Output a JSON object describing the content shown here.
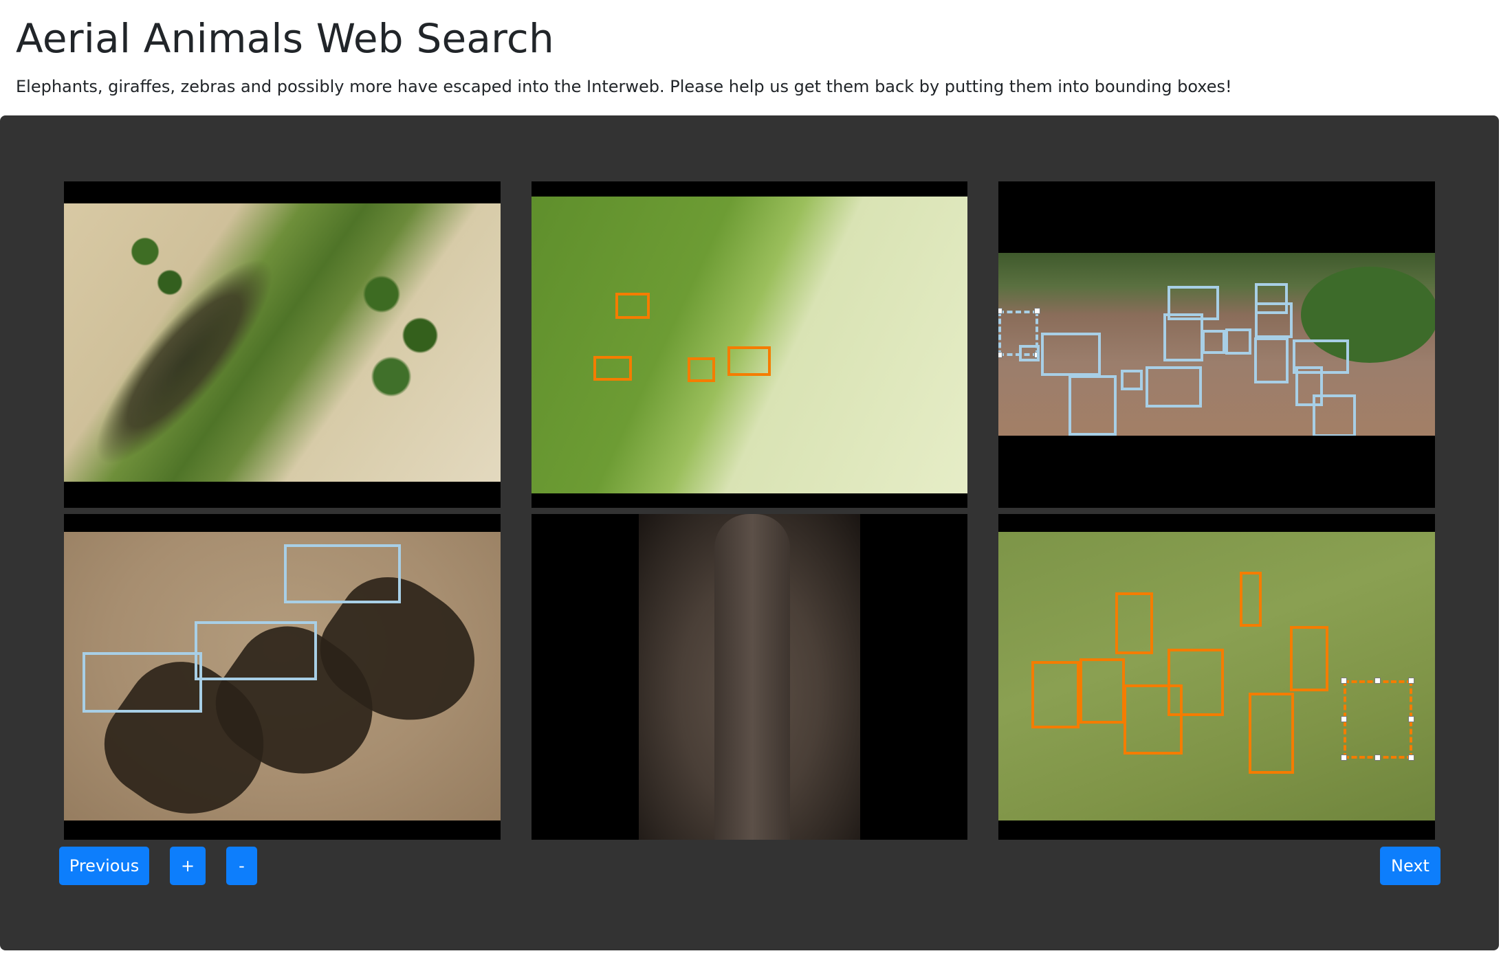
{
  "page": {
    "title": "Aerial Animals Web Search",
    "subtitle": "Elephants, giraffes, zebras and possibly more have escaped into the Interweb. Please help us get them back by putting them into bounding boxes!"
  },
  "images": [
    {
      "id": "grid-image-1",
      "subject": "herd of animals crossing grassland",
      "annotations": 0
    },
    {
      "id": "grid-image-2",
      "subject": "zebras in marsh",
      "label_color": "#f57c00",
      "annotations": 5
    },
    {
      "id": "grid-image-3",
      "subject": "elephants in river",
      "label_color": "#a8cfe6",
      "annotations": 21
    },
    {
      "id": "grid-image-4",
      "subject": "three elephants with shadows",
      "label_color": "#a8cfe6",
      "annotations": 3
    },
    {
      "id": "grid-image-5",
      "subject": "elephant trunk close-up",
      "annotations": 0
    },
    {
      "id": "grid-image-6",
      "subject": "zebra herd on grass",
      "label_color": "#f57c00",
      "annotations": 10
    }
  ],
  "controls": {
    "previous_label": "Previous",
    "zoom_in_label": "+",
    "zoom_out_label": "-",
    "next_label": "Next"
  },
  "colors": {
    "panel": "#333333",
    "button": "#0d7efc",
    "elephant_box": "#a8cfe6",
    "zebra_box": "#f57c00"
  }
}
